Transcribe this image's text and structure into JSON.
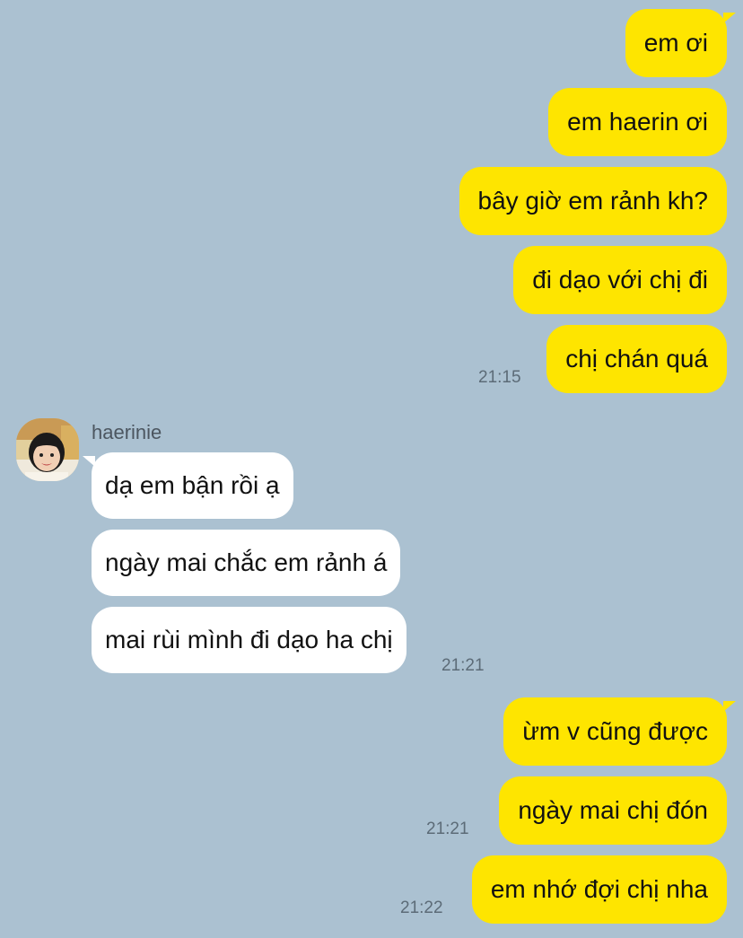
{
  "colors": {
    "background": "#abc1d1",
    "outgoing_bubble": "#fee500",
    "incoming_bubble": "#ffffff",
    "timestamp": "#5c6b77"
  },
  "messages": [
    {
      "direction": "out",
      "text": "em ơi"
    },
    {
      "direction": "out",
      "text": "em haerin ơi"
    },
    {
      "direction": "out",
      "text": "bây giờ em rảnh kh?"
    },
    {
      "direction": "out",
      "text": "đi dạo với chị đi"
    },
    {
      "direction": "out",
      "text": "chị chán quá"
    },
    {
      "direction": "in",
      "text": "dạ em bận rồi ạ"
    },
    {
      "direction": "in",
      "text": "ngày mai chắc em rảnh á"
    },
    {
      "direction": "in",
      "text": "mai rùi mình đi dạo ha chị"
    },
    {
      "direction": "out",
      "text": "ừm v cũng được"
    },
    {
      "direction": "out",
      "text": "ngày mai chị đón"
    },
    {
      "direction": "out",
      "text": "em nhớ đợi chị nha"
    }
  ],
  "timestamps": [
    "21:15",
    "21:21",
    "21:21",
    "21:22"
  ],
  "sender": {
    "name": "haerinie",
    "avatar_icon": "profile-photo-girl"
  }
}
